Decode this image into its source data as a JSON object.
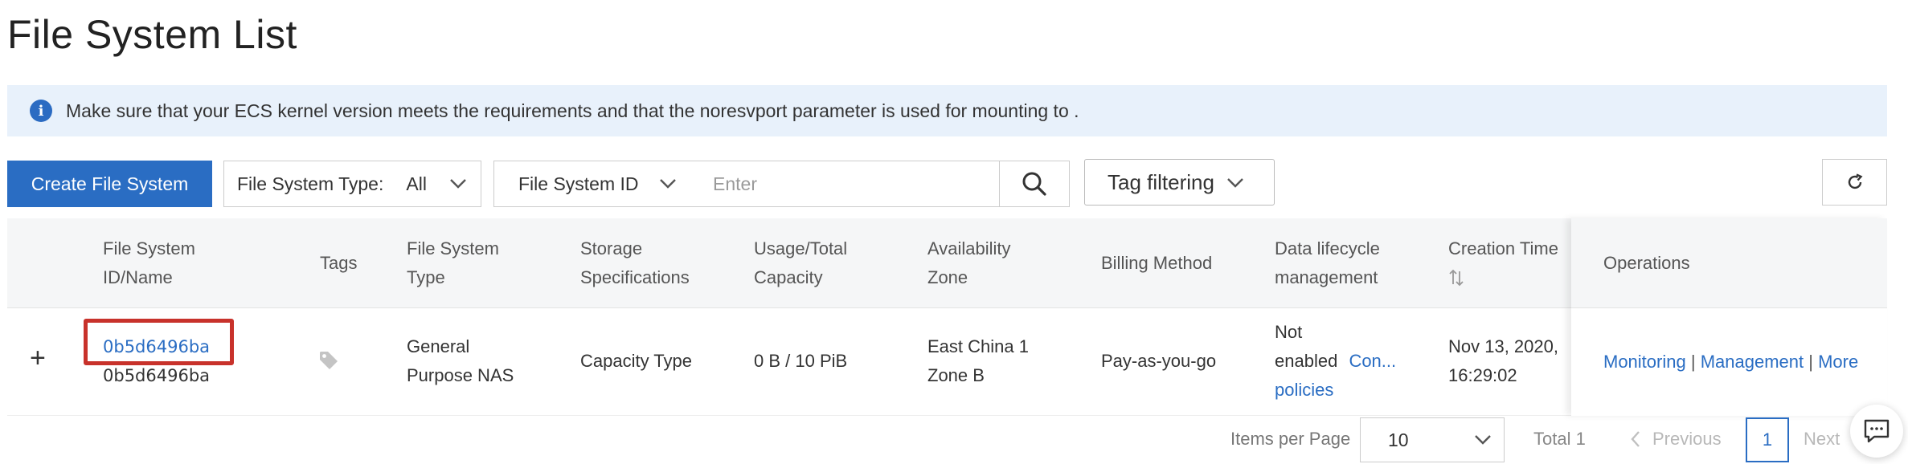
{
  "page": {
    "title": "File System List"
  },
  "notice": {
    "text": "Make sure that your ECS kernel version meets the requirements and that the noresvport parameter is used for mounting to ."
  },
  "toolbar": {
    "create_label": "Create File System",
    "fs_type_label": "File System Type:",
    "fs_type_value": "All",
    "search_field_value": "File System ID",
    "search_placeholder": "Enter",
    "tag_filter_label": "Tag filtering"
  },
  "table": {
    "headers": {
      "id_name_1": "File System",
      "id_name_2": "ID/Name",
      "tags": "Tags",
      "type_1": "File System",
      "type_2": "Type",
      "storage_1": "Storage",
      "storage_2": "Specifications",
      "usage_1": "Usage/Total",
      "usage_2": "Capacity",
      "zone_1": "Availability",
      "zone_2": "Zone",
      "billing": "Billing Method",
      "lifecycle_1": "Data lifecycle",
      "lifecycle_2": "management",
      "created": "Creation Time",
      "operations": "Operations"
    },
    "rows": [
      {
        "expand": "+",
        "id": "0b5d6496ba",
        "name": "0b5d6496ba",
        "type_1": "General",
        "type_2": "Purpose NAS",
        "storage": "Capacity Type",
        "usage": "0 B / 10 PiB",
        "zone_1": "East China 1",
        "zone_2": "Zone B",
        "billing": "Pay-as-you-go",
        "lifecycle_1": "Not",
        "lifecycle_2": "enabled",
        "lifecycle_link": "Con...",
        "lifecycle_link2": "policies",
        "created_1": "Nov 13, 2020,",
        "created_2": "16:29:02",
        "op_monitoring": "Monitoring",
        "op_management": "Management",
        "op_more": "More",
        "op_sep": "|"
      }
    ]
  },
  "pagination": {
    "items_per_page_label": "Items per Page",
    "page_size": "10",
    "total": "Total 1",
    "previous": "Previous",
    "current_page": "1",
    "next": "Next"
  },
  "icons": {
    "info": "info-icon",
    "search": "search-icon",
    "refresh": "refresh-icon",
    "tag": "tag-icon",
    "sort": "sort-icon",
    "chat": "chat-icon"
  },
  "colors": {
    "primary": "#2a6dc3",
    "notice_bg": "#e8f1fb",
    "highlight": "#c8322b"
  }
}
